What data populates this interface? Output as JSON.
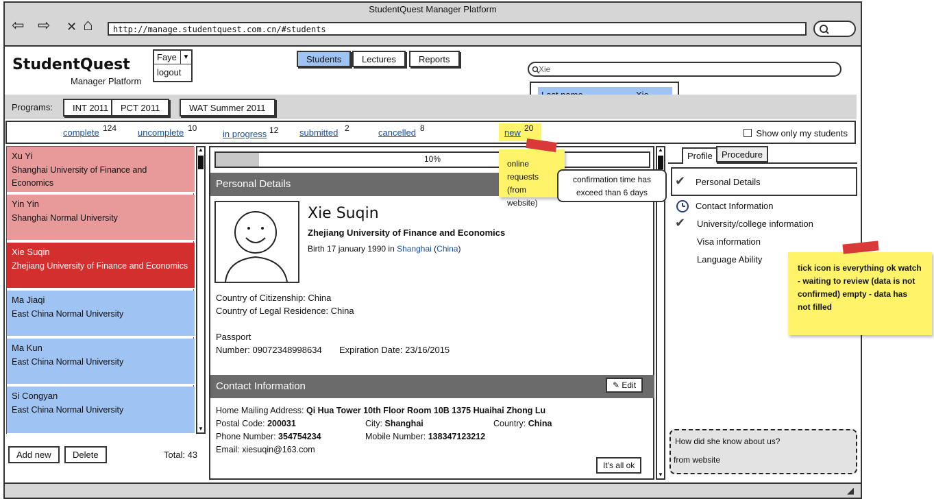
{
  "window": {
    "title": "StudentQuest Manager Platform",
    "url": "http://manage.studentquest.com.cn/#students",
    "nav_back": "⇦",
    "nav_forward": "⇨",
    "nav_close": "✕",
    "nav_home": "⌂"
  },
  "header": {
    "logo": "StudentQuest",
    "logo_sub": "Manager Platform",
    "user": "Faye",
    "logout": "logout",
    "tabs": [
      "Students",
      "Lectures",
      "Reports"
    ],
    "search_value": "Xie",
    "dropdown": {
      "label": "Last name",
      "value": "Xie"
    }
  },
  "programs": {
    "label": "Programs:",
    "items": [
      "INT 2011",
      "PCT 2011",
      "WAT Summer 2011"
    ]
  },
  "status": {
    "items": [
      {
        "label": "complete",
        "count": "124"
      },
      {
        "label": "uncomplete",
        "count": "10"
      },
      {
        "label": "in progress",
        "count": "12"
      },
      {
        "label": "submitted",
        "count": "2"
      },
      {
        "label": "cancelled",
        "count": "8"
      },
      {
        "label": "new",
        "count": "20"
      }
    ],
    "show_only_mine": "Show only my students"
  },
  "students": [
    {
      "name": "Xu Yi",
      "uni": "Shanghai University of Finance and Economics"
    },
    {
      "name": "Yin Yin",
      "uni": "Shanghai Normal University"
    },
    {
      "name": "Xie Suqin",
      "uni": "Zhejiang University of Finance and Economics"
    },
    {
      "name": "Ma Jiaqi",
      "uni": "East China Normal University"
    },
    {
      "name": "Ma Kun",
      "uni": "East China Normal University"
    },
    {
      "name": "Si Congyan",
      "uni": "East China Normal University"
    }
  ],
  "list_footer": {
    "add": "Add new",
    "delete": "Delete",
    "total": "Total: 43"
  },
  "detail": {
    "progress_label": "10%",
    "progress_value": 0.1,
    "personal_header": "Personal Details",
    "name": "Xie Suqin",
    "university": "Zhejiang University of Finance and Economics",
    "birth_prefix": "Birth 17 january 1990 in ",
    "birth_city": "Shanghai",
    "birth_country": "China",
    "citizenship": "Country of Citizenship: China",
    "residence": "Country of Legal Residence: China",
    "passport_label": "Passport",
    "passport_number": "Number: 09072348998634",
    "passport_expiry": "Expiration Date: 23/16/2015",
    "contact_header": "Contact Information",
    "edit": "Edit",
    "address_label": "Home Mailing Address:",
    "address": "Qi Hua Tower 10th Floor Room 10B 1375 Huaihai Zhong Lu",
    "postal_label": "Postal Code:",
    "postal": "200031",
    "city_label": "City:",
    "city": "Shanghai",
    "country_label": "Country:",
    "country": "China",
    "phone_label": "Phone Number:",
    "phone": "354754234",
    "mobile_label": "Mobile Number:",
    "mobile": "138347123212",
    "email": "Email: xiesuqin@163.com",
    "ok_button": "It's all ok"
  },
  "right": {
    "tabs": [
      "Profile",
      "Procedure"
    ],
    "items": [
      {
        "label": "Personal Details",
        "state": "check"
      },
      {
        "label": "Contact Information",
        "state": "watch"
      },
      {
        "label": "University/college information",
        "state": "check"
      },
      {
        "label": "Visa information",
        "state": "empty"
      },
      {
        "label": "Language Ability",
        "state": "empty"
      }
    ],
    "question": "How did she know about us?",
    "answer": "from website"
  },
  "notes": {
    "online": "online requests (from website)",
    "bubble": "confirmation time has exceed than 6 days",
    "legend": "tick icon is everything ok watch - waiting to review (data is not confirmed) empty - data has not filled"
  },
  "colors": {
    "red_row": "#e89a9a",
    "selected_row": "#d32f2f",
    "blue_row": "#9fc3f3",
    "section_bg": "#6b6b6b",
    "sticky": "#fff36a"
  }
}
